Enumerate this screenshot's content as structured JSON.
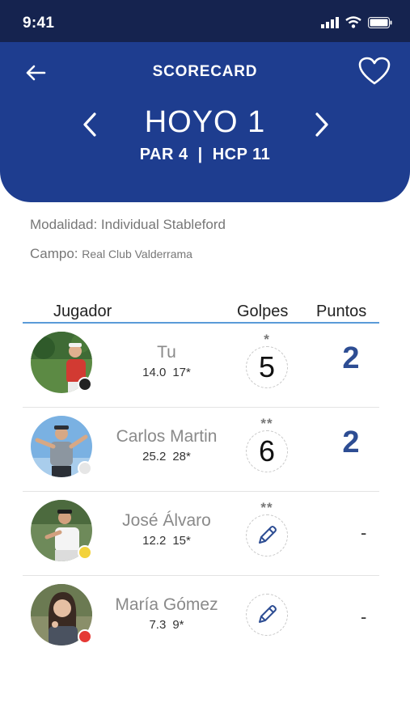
{
  "status_bar": {
    "time": "9:41"
  },
  "header": {
    "title": "SCORECARD",
    "hole_title": "HOYO 1",
    "par": "PAR 4",
    "separator": "|",
    "hcp": "HCP 11"
  },
  "info": {
    "modality_label": "Modalidad:",
    "modality_value": "Individual Stableford",
    "course_label": "Campo:",
    "course_value": "Real Club Valderrama"
  },
  "table": {
    "headers": {
      "player": "Jugador",
      "strokes": "Golpes",
      "points": "Puntos"
    },
    "rows": [
      {
        "name": "Tu",
        "hcp_index": "14.0",
        "playing_hcp": "17*",
        "stars": "*",
        "strokes": "5",
        "points": "2",
        "tee_color": "#222222"
      },
      {
        "name": "Carlos Martin",
        "hcp_index": "25.2",
        "playing_hcp": "28*",
        "stars": "**",
        "strokes": "6",
        "points": "2",
        "tee_color": "#e6e6e6"
      },
      {
        "name": "José Álvaro",
        "hcp_index": "12.2",
        "playing_hcp": "15*",
        "stars": "**",
        "strokes": "",
        "points": "-",
        "tee_color": "#f3d23b"
      },
      {
        "name": "María Gómez",
        "hcp_index": "7.3",
        "playing_hcp": "9*",
        "stars": "",
        "strokes": "",
        "points": "-",
        "tee_color": "#e53935"
      }
    ]
  },
  "colors": {
    "header_bg": "#1e3d8f",
    "status_bg": "#15234f",
    "accent_points": "#2d4d93",
    "divider": "#5a9bd8"
  }
}
